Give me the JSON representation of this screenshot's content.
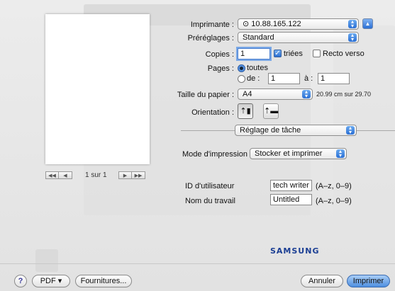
{
  "printer": {
    "label": "Imprimante :",
    "value": "10.88.165.122"
  },
  "presets": {
    "label": "Préréglages :",
    "value": "Standard"
  },
  "copies": {
    "label": "Copies :",
    "value": "1",
    "collated_label": "triées",
    "collated": true,
    "duplex_label": "Recto verso",
    "duplex": false
  },
  "pages": {
    "label": "Pages :",
    "all_label": "toutes",
    "from_label": "de :",
    "from_value": "1",
    "to_label": "à :",
    "to_value": "1"
  },
  "paper": {
    "label": "Taille du papier :",
    "value": "A4",
    "dimensions": "20.99 cm sur 29.70"
  },
  "orientation": {
    "label": "Orientation :"
  },
  "panel_select": {
    "value": "Réglage de tâche"
  },
  "print_mode": {
    "label": "Mode d'impression",
    "value": "Stocker et imprimer"
  },
  "user_id": {
    "label": "ID d'utilisateur",
    "value": "tech writer",
    "hint": "(A–z, 0–9)"
  },
  "job_name": {
    "label": "Nom du travail",
    "value": "Untitled",
    "hint": "(A–z, 0–9)"
  },
  "preview": {
    "page_count": "1 sur 1"
  },
  "brand": "SAMSUNG",
  "buttons": {
    "help": "?",
    "pdf": "PDF ▾",
    "supplies": "Fournitures...",
    "cancel": "Annuler",
    "print": "Imprimer"
  },
  "colors": {
    "accent": "#2a6fd4",
    "brand": "#1c3f94"
  }
}
